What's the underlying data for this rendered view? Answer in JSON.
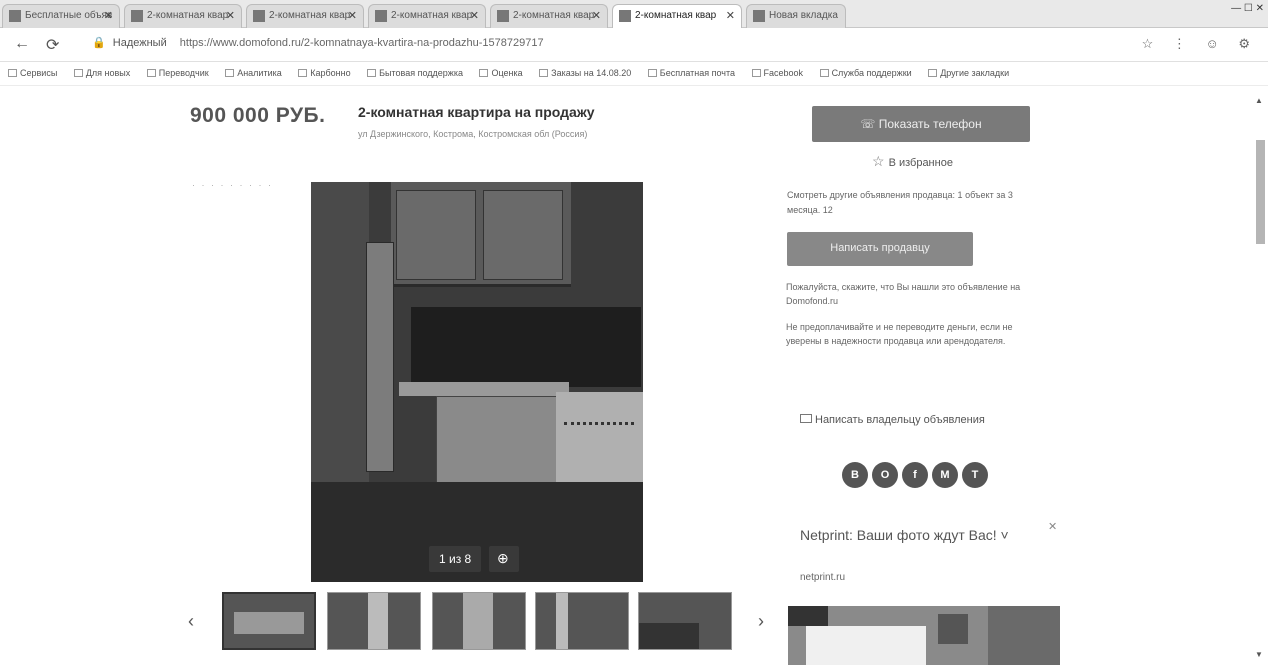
{
  "browser": {
    "tabs": [
      {
        "label": "Бесплатные объяв"
      },
      {
        "label": "2-комнатная квар"
      },
      {
        "label": "2-комнатная квар"
      },
      {
        "label": "2-комнатная квар"
      },
      {
        "label": "2-комнатная квар"
      },
      {
        "label": "2-комнатная квар",
        "active": true
      },
      {
        "label": "Новая вкладка"
      }
    ],
    "window_controls": "—  ☐  ✕",
    "url_host": "Надежный",
    "url": "https://www.domofond.ru/2-komnatnaya-kvartira-na-prodazhu-1578729717",
    "bookmarks": [
      "Сервисы",
      "Для новых",
      "Переводчик",
      "Аналитика",
      "Карбонно",
      "Бытовая поддержка",
      "Оценка",
      "Заказы на 14.08.20",
      "Бесплатная почта",
      "Facebook",
      "Служба поддержки",
      "Другие закладки"
    ]
  },
  "listing": {
    "price": "900 000 РУБ.",
    "title": "2-комнатная квартира на продажу",
    "subtitle": "ул Дзержинского, Кострома, Костромская обл (Россия)",
    "dots": "· · · · · · · · ·",
    "photo_counter": "1 из 8",
    "zoom_glyph": "⊕"
  },
  "actions": {
    "show_phone": "Показать телефон",
    "favorite": "В избранное",
    "other_ads": "Смотреть другие объявления продавца: 1 объект за 3 месяца. 12",
    "write_seller": "Написать продавцу",
    "note1": "Пожалуйста, скажите, что Вы нашли это объявление на Domofond.ru",
    "note2": "Не предоплачивайте и не переводите деньги, если не уверены в надежности продавца или арендодателя.",
    "complain": "Написать владельцу объявления",
    "socials": [
      "В",
      "О",
      "f",
      "М",
      "Т"
    ]
  },
  "ad": {
    "title": "Netprint: Ваши фото ждут Вас! ˅",
    "host": "netprint.ru",
    "close": "✕"
  },
  "icons": {
    "back": "←",
    "reload": "⟳",
    "prev_thumb": "‹",
    "next_thumb": "›",
    "star": "☆",
    "phone": "☏",
    "scroll_up": "▲",
    "scroll_down": "▼",
    "addr_right": "☆ ⋮ ☺ ⚙"
  }
}
